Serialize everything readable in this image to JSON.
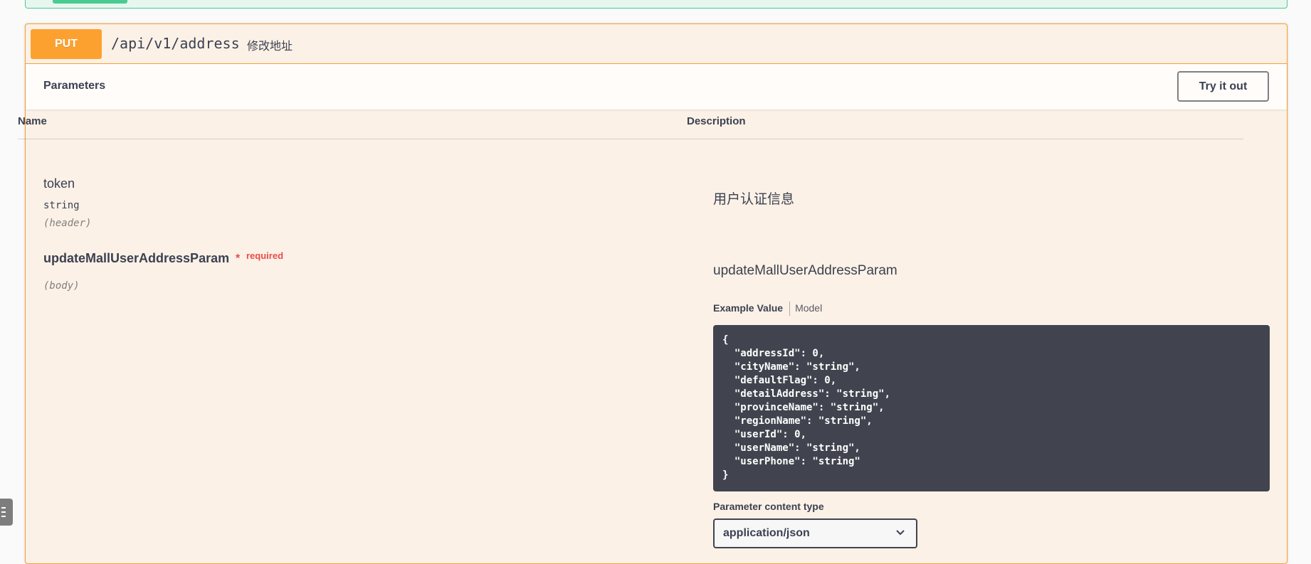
{
  "operation": {
    "method": "PUT",
    "path": "/api/v1/address",
    "summary": "修改地址"
  },
  "parameters_section": {
    "title": "Parameters",
    "try_button": "Try it out"
  },
  "table": {
    "col_name": "Name",
    "col_description": "Description"
  },
  "params": [
    {
      "name": "token",
      "type": "string",
      "in": "(header)",
      "description": "用户认证信息"
    },
    {
      "name": "updateMallUserAddressParam",
      "required_star": "*",
      "required_label": "required",
      "in": "(body)",
      "description": "updateMallUserAddressParam"
    }
  ],
  "example": {
    "tab_example": "Example Value",
    "tab_model": "Model",
    "code": "{\n  \"addressId\": 0,\n  \"cityName\": \"string\",\n  \"defaultFlag\": 0,\n  \"detailAddress\": \"string\",\n  \"provinceName\": \"string\",\n  \"regionName\": \"string\",\n  \"userId\": 0,\n  \"userName\": \"string\",\n  \"userPhone\": \"string\"\n}"
  },
  "content_type": {
    "label": "Parameter content type",
    "selected": "application/json"
  },
  "colors": {
    "put_accent": "#fca130",
    "put_background": "#fcf1e6",
    "post_accent": "#49cc90",
    "code_background": "#41444e",
    "required": "#e94b4b"
  },
  "icons": {
    "select_chevron": "chevron-down-icon",
    "side_tab": "menu-icon"
  }
}
